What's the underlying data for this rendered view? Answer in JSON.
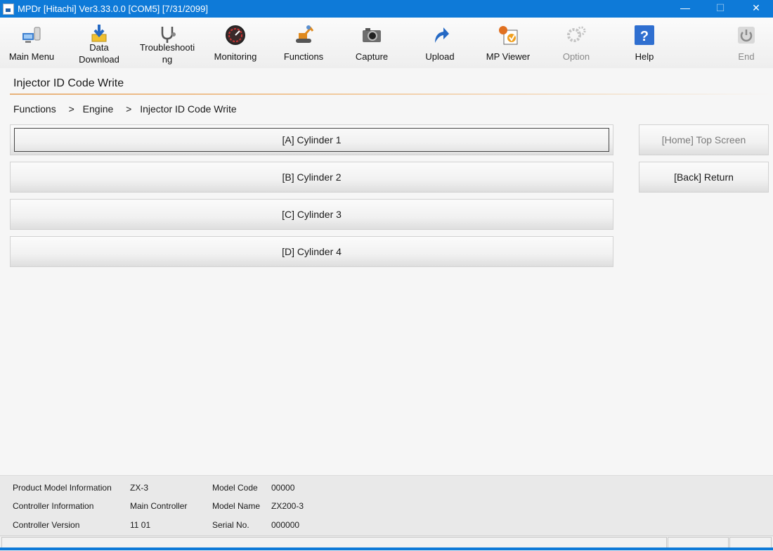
{
  "window": {
    "title": "MPDr [Hitachi]  Ver3.33.0.0 [COM5] [7/31/2099]",
    "minimize": "—",
    "maximize": "☐",
    "close": "✕"
  },
  "toolbar": {
    "main_menu": "Main Menu",
    "data_download_1": "Data",
    "data_download_2": "Download",
    "troubleshooting_1": "Troubleshooti",
    "troubleshooting_2": "ng",
    "monitoring": "Monitoring",
    "functions": "Functions",
    "capture": "Capture",
    "upload": "Upload",
    "mp_viewer": "MP Viewer",
    "option": "Option",
    "help": "Help",
    "end": "End"
  },
  "page": {
    "title": "Injector ID Code Write",
    "breadcrumb": [
      "Functions",
      ">",
      "Engine",
      ">",
      "Injector ID Code Write"
    ]
  },
  "cylinders": [
    "[A] Cylinder 1",
    "[B] Cylinder 2",
    "[C] Cylinder 3",
    "[D] Cylinder 4"
  ],
  "nav": {
    "home": "[Home] Top Screen",
    "back": "[Back] Return"
  },
  "footer": {
    "product_model_label": "Product Model Information",
    "product_model_value": "ZX-3",
    "controller_info_label": "Controller Information",
    "controller_info_value": "Main Controller",
    "controller_version_label": "Controller Version",
    "controller_version_value": "11 01",
    "model_code_label": "Model Code",
    "model_code_value": "00000",
    "model_name_label": "Model Name",
    "model_name_value": "ZX200-3",
    "serial_label": "Serial No.",
    "serial_value": "000000"
  },
  "colors": {
    "titlebar": "#0e7ad8",
    "accent_rule": "#e8b27a"
  }
}
